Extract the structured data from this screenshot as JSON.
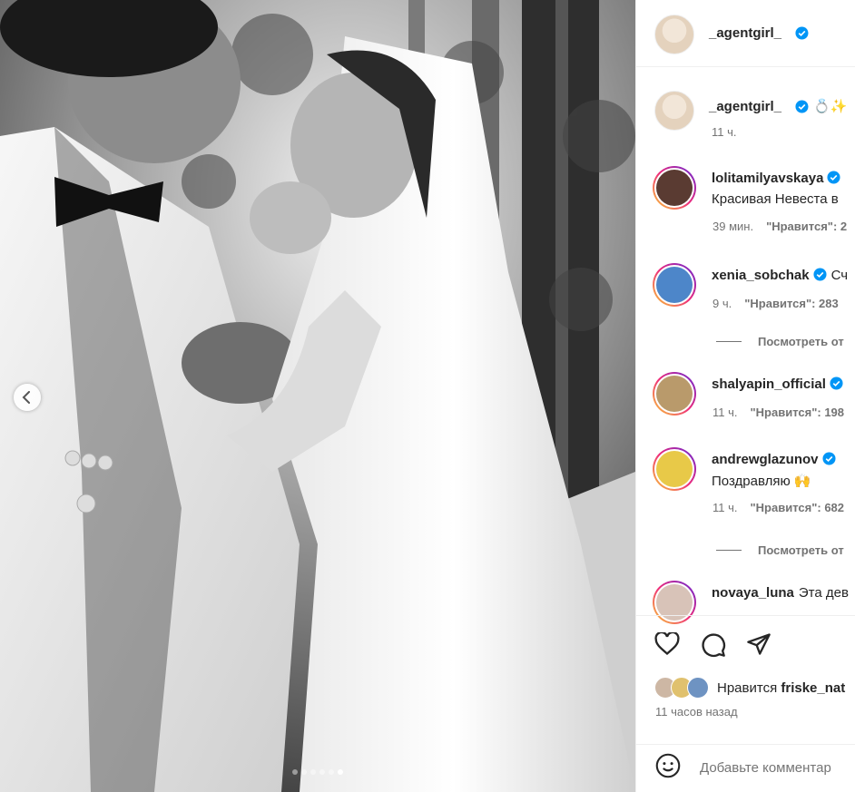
{
  "post": {
    "author": "_agentgirl_",
    "carousel": {
      "dot_count": 6,
      "active_index": 5
    }
  },
  "caption": {
    "username": "_agentgirl_",
    "emoji": "💍✨",
    "time": "11 ч."
  },
  "comments": [
    {
      "username": "lolitamilyavskaya",
      "verified": true,
      "text": "Красивая Невеста в",
      "time": "39 мин.",
      "likes": "\"Нравится\": 2",
      "avatar_color": "#5a3b32"
    },
    {
      "username": "xenia_sobchak",
      "verified": true,
      "text": "Сч",
      "time": "9 ч.",
      "likes": "\"Нравится\": 283",
      "avatar_color": "#4d86c9"
    },
    {
      "username": "shalyapin_official",
      "verified": true,
      "text": "",
      "time": "11 ч.",
      "likes": "\"Нравится\": 198",
      "avatar_color": "#b99a6b"
    },
    {
      "username": "andrewglazunov",
      "verified": true,
      "text": "Поздравляю 🙌",
      "time": "11 ч.",
      "likes": "\"Нравится\": 682",
      "avatar_color": "#e8c948"
    },
    {
      "username": "novaya_luna",
      "verified": false,
      "text": "Эта дев",
      "avatar_color": "#d8c3b8"
    }
  ],
  "replies_label": "Посмотреть от",
  "likes": {
    "prefix": "Нравится",
    "user": "friske_nat"
  },
  "posted": "11 часов назад",
  "comment_input": {
    "placeholder": "Добавьте комментар"
  },
  "icons": {
    "like": "heart-icon",
    "comment": "comment-icon",
    "share": "share-icon",
    "emoji": "emoji-icon",
    "verified": "verified-badge-icon",
    "prev": "chevron-left-icon"
  },
  "colors": {
    "verified": "#0095f6",
    "secondary_text": "#737373",
    "border": "#efefef"
  }
}
